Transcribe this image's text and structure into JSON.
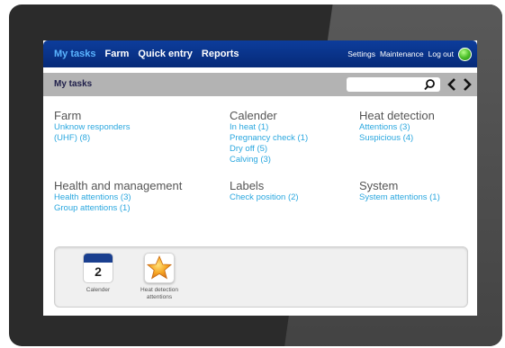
{
  "nav": {
    "items": [
      "My tasks",
      "Farm",
      "Quick entry",
      "Reports"
    ],
    "right": [
      "Settings",
      "Maintenance",
      "Log out"
    ]
  },
  "titlebar": {
    "title": "My tasks",
    "search_value": ""
  },
  "sections": {
    "farm": {
      "heading": "Farm",
      "links": [
        "Unknow responders",
        "(UHF) (8)"
      ]
    },
    "calender": {
      "heading": "Calender",
      "links": [
        "In heat (1)",
        "Pregnancy check (1)",
        "Dry off (5)",
        "Calving (3)"
      ]
    },
    "heat": {
      "heading": "Heat detection",
      "links": [
        "Attentions (3)",
        "Suspicious (4)"
      ]
    },
    "health": {
      "heading": "Health and management",
      "links": [
        "Health attentions (3)",
        "Group attentions (1)"
      ]
    },
    "labels": {
      "heading": "Labels",
      "links": [
        "Check position (2)"
      ]
    },
    "system": {
      "heading": "System",
      "links": [
        "System attentions (1)"
      ]
    }
  },
  "dock": {
    "calendar_tile": {
      "day": "2",
      "caption": "Calender"
    },
    "heat_tile": {
      "caption_line1": "Heat detection",
      "caption_line2": "attentions"
    }
  },
  "colors": {
    "nav_bg": "#0d3d9c",
    "active_nav": "#5ab4ff",
    "link": "#2aa7df",
    "titlebar": "#b3b3b3"
  },
  "icons": [
    "search-icon",
    "arrow-left-icon",
    "arrow-right-icon",
    "globe-icon",
    "calendar-icon",
    "star-icon"
  ]
}
